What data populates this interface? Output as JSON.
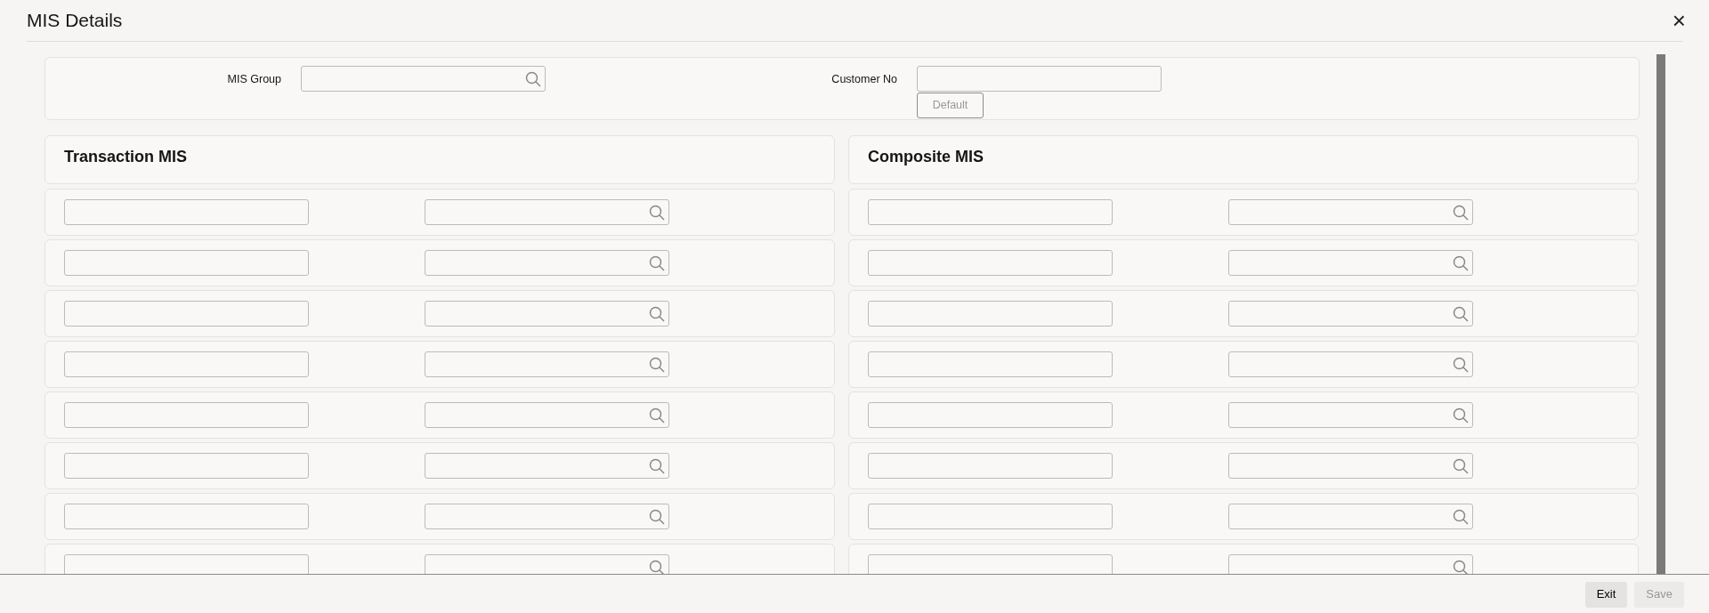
{
  "window": {
    "title": "MIS Details",
    "close": "×"
  },
  "header_fields": [
    {
      "label": "MIS Group",
      "kind": "lookup"
    },
    {
      "label": "Customer No",
      "kind": "text",
      "button": {
        "label": "Default",
        "disabled": true
      }
    }
  ],
  "sections": [
    {
      "title": "Transaction MIS",
      "rows": [
        {
          "kind": "text-lookup"
        },
        {
          "kind": "text-lookup"
        },
        {
          "kind": "text-lookup"
        },
        {
          "kind": "text-lookup"
        },
        {
          "kind": "text-lookup"
        },
        {
          "kind": "text-lookup"
        },
        {
          "kind": "text-lookup"
        },
        {
          "kind": "text-lookup"
        }
      ]
    },
    {
      "title": "Composite MIS",
      "rows": [
        {
          "kind": "text-lookup"
        },
        {
          "kind": "text-lookup"
        },
        {
          "kind": "text-lookup"
        },
        {
          "kind": "text-lookup"
        },
        {
          "kind": "text-lookup"
        },
        {
          "kind": "text-lookup"
        },
        {
          "kind": "text-lookup"
        },
        {
          "kind": "text-lookup"
        }
      ]
    }
  ],
  "footer_buttons": [
    {
      "label": "Exit",
      "disabled": false
    },
    {
      "label": "Save",
      "disabled": true
    }
  ]
}
